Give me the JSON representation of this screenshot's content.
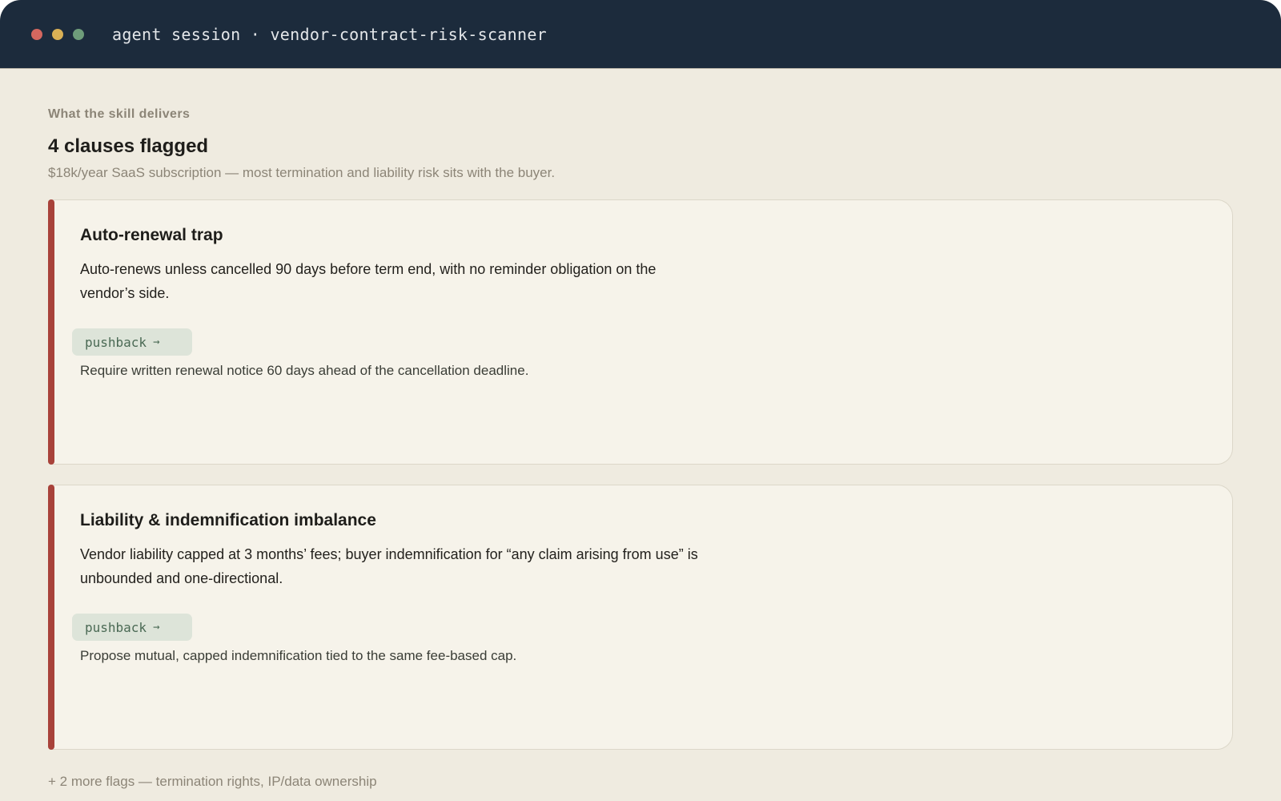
{
  "window": {
    "title": "agent session · vendor-contract-risk-scanner"
  },
  "summary": {
    "eyebrow": "What the skill delivers",
    "heading": "4 clauses flagged",
    "subtitle": "$18k/year SaaS subscription — most termination and liability risk sits with the buyer."
  },
  "flags": [
    {
      "title": "Auto-renewal trap",
      "description": "Auto-renews unless cancelled 90 days before term end, with no reminder obligation on the vendor’s side.",
      "action_label": "pushback",
      "recommendation": "Require written renewal notice 60 days ahead of the cancellation deadline."
    },
    {
      "title": "Liability & indemnification imbalance",
      "description": "Vendor liability capped at 3 months’ fees; buyer indemnification for “any claim arising from use” is unbounded and one-directional.",
      "action_label": "pushback",
      "recommendation": "Propose mutual, capped indemnification tied to the same fee-based cap."
    }
  ],
  "footer": {
    "more_flags": "+ 2 more flags — termination rights, IP/data ownership"
  },
  "colors": {
    "titlebar": "#1c2b3c",
    "severity_bar": "#a8423a",
    "pushback_bg": "#dde4d9"
  },
  "icons": {
    "arrow": "→"
  }
}
